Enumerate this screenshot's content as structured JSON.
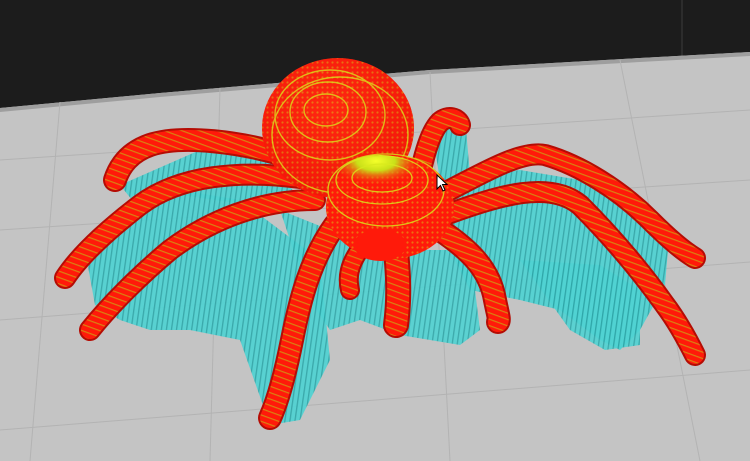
{
  "app": {
    "view": "slicer-3d-layer-preview",
    "model": "spider-model",
    "colors": {
      "background": "#1c1c1c",
      "build_plate": "#c4c4c4",
      "plate_edge": "#9e9e9e",
      "perimeter": "#ff1a0a",
      "top_layer_highlight": "#d7e81a",
      "support": "#4fd2d2",
      "support_dark": "#2ea6a8",
      "grid_line": "#a9a9a9"
    },
    "icons": {
      "cursor": "arrow-pointer-icon"
    }
  }
}
